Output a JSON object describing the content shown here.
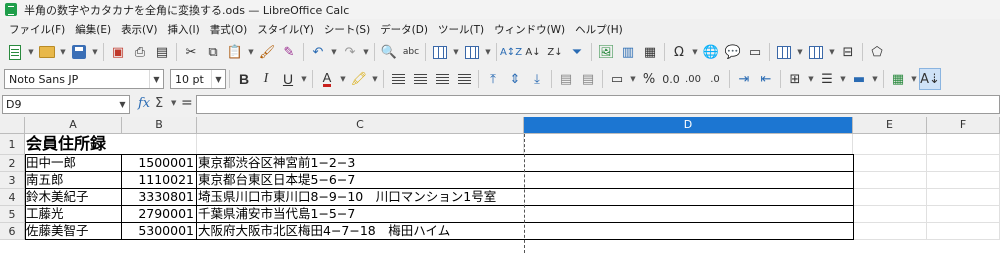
{
  "window": {
    "title": "半角の数字やカタカナを全角に変換する.ods — LibreOffice Calc"
  },
  "menu": [
    "ファイル(F)",
    "編集(E)",
    "表示(V)",
    "挿入(I)",
    "書式(O)",
    "スタイル(Y)",
    "シート(S)",
    "データ(D)",
    "ツール(T)",
    "ウィンドウ(W)",
    "ヘルプ(H)"
  ],
  "format_bar": {
    "font_name": "Noto Sans JP",
    "font_size": "10 pt"
  },
  "formula_bar": {
    "name_box": "D9",
    "fx_symbol": "fx",
    "sigma_symbol": "Σ",
    "equals_symbol": "=",
    "content": ""
  },
  "columns": [
    "A",
    "B",
    "C",
    "D",
    "E",
    "F"
  ],
  "active_column": "D",
  "rows": [
    "1",
    "2",
    "3",
    "4",
    "5",
    "6"
  ],
  "table": {
    "title": "会員住所録",
    "records": [
      {
        "name": "田中一郎",
        "zip": "1500001",
        "address": "東京都渋谷区神宮前1−2−3"
      },
      {
        "name": "南五郎",
        "zip": "1110021",
        "address": "東京都台東区日本堤5−6−7"
      },
      {
        "name": "鈴木美紀子",
        "zip": "3330801",
        "address": "埼玉県川口市東川口8−9−10　川口マンション1号室"
      },
      {
        "name": "工藤光",
        "zip": "2790001",
        "address": "千葉県浦安市当代島1−5−7"
      },
      {
        "name": "佐藤美智子",
        "zip": "5300001",
        "address": "大阪府大阪市北区梅田4−7−18　梅田ハイム"
      }
    ]
  },
  "icons": {
    "toolbar1": [
      "new-document-icon",
      "open-folder-icon",
      "save-icon",
      "export-pdf-icon",
      "print-icon",
      "print-preview-icon",
      "cut-icon",
      "copy-icon",
      "paste-icon",
      "clone-formatting-icon",
      "clear-formatting-icon",
      "undo-icon",
      "redo-icon",
      "find-replace-icon",
      "spelling-icon",
      "row-icon",
      "column-icon",
      "sort-icon",
      "sort-ascending-icon",
      "sort-descending-icon",
      "autofilter-icon",
      "image-icon",
      "chart-icon",
      "pivot-table-icon",
      "special-character-icon",
      "hyperlink-icon",
      "comment-icon",
      "headers-footers-icon",
      "define-print-area-icon",
      "freeze-rows-columns-icon",
      "split-window-icon",
      "show-draw-functions-icon"
    ],
    "toolbar2": [
      "bold-icon",
      "italic-icon",
      "underline-icon",
      "font-color-icon",
      "highlight-icon",
      "align-left-icon",
      "align-center-icon",
      "align-right-icon",
      "justify-icon",
      "align-top-icon",
      "align-middle-icon",
      "align-bottom-icon",
      "merge-cells-icon",
      "wrap-text-icon",
      "number-format-icon",
      "percent-icon",
      "decimal-icon",
      "add-decimal-icon",
      "delete-decimal-icon",
      "increase-indent-icon",
      "decrease-indent-icon",
      "borders-icon",
      "border-style-icon",
      "border-color-icon",
      "conditional-format-icon",
      "text-direction-icon"
    ]
  }
}
